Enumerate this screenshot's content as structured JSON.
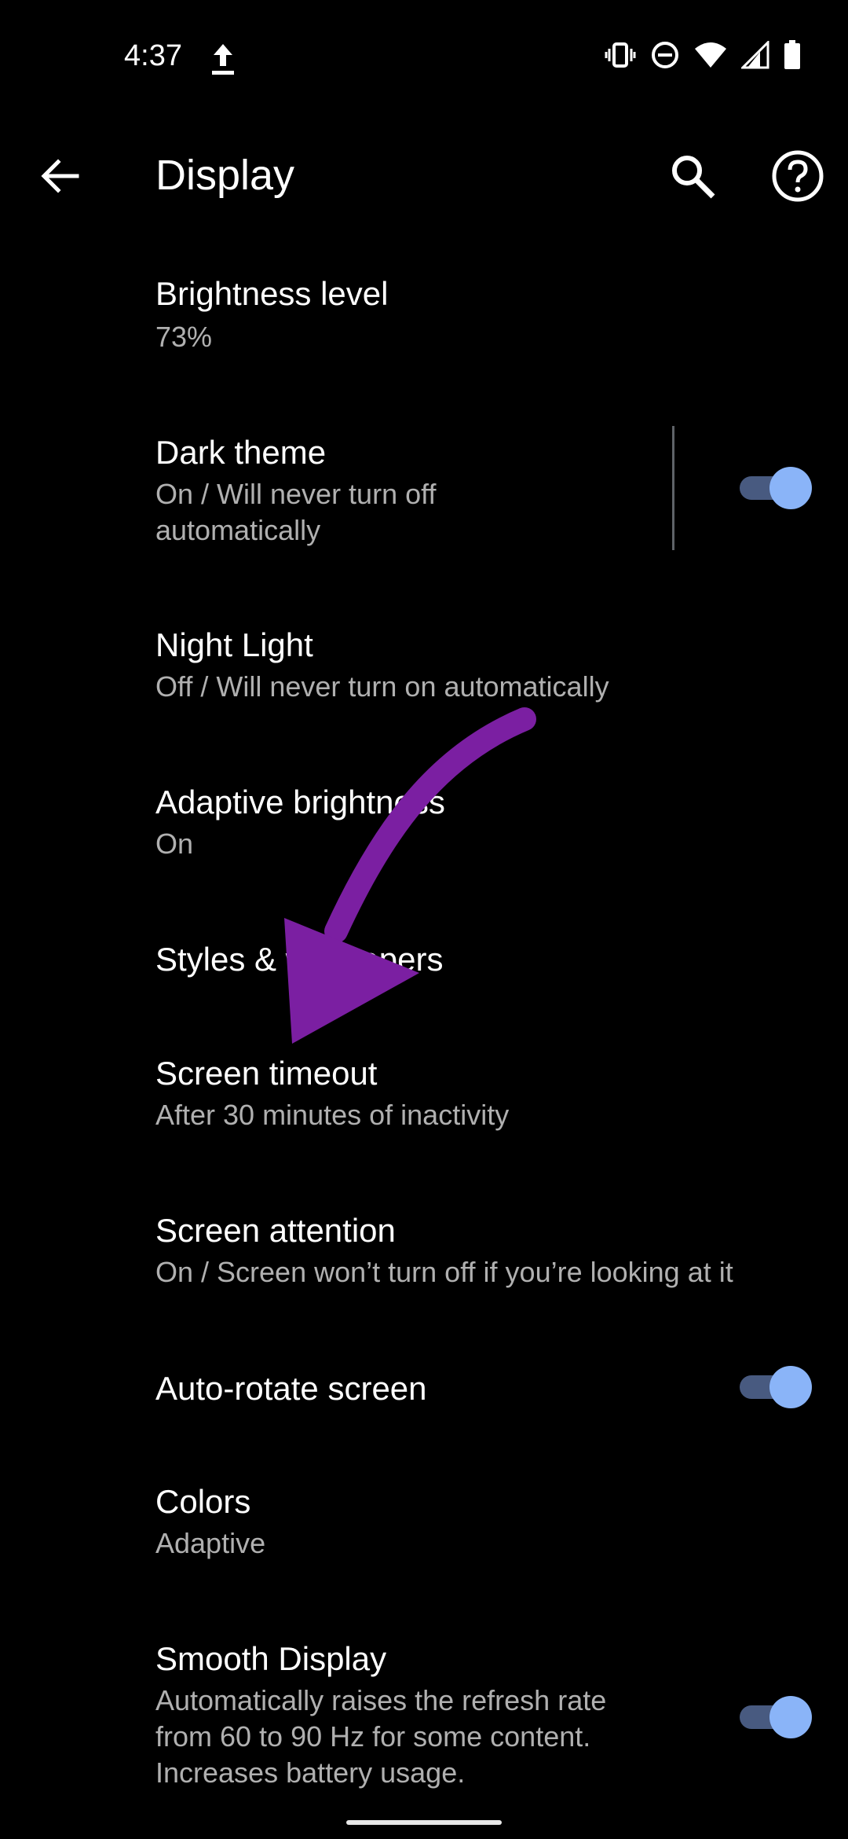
{
  "status_bar": {
    "time": "4:37",
    "icons": [
      "upload-icon",
      "vibrate-icon",
      "do-not-disturb-icon",
      "wifi-icon",
      "signal-icon",
      "battery-icon"
    ]
  },
  "app_bar": {
    "title": "Display",
    "back_icon": "arrow-back-icon",
    "search_icon": "search-icon",
    "help_icon": "help-icon"
  },
  "settings": [
    {
      "title": "Brightness level",
      "summary": "73%"
    },
    {
      "title": "Dark theme",
      "summary": "On / Will never turn off\nautomatically",
      "toggle": true
    },
    {
      "title": "Night Light",
      "summary": "Off / Will never turn on automatically"
    },
    {
      "title": "Adaptive brightness",
      "summary": "On"
    },
    {
      "title": "Styles & wallpapers"
    },
    {
      "title": "Screen timeout",
      "summary": "After 30 minutes of inactivity"
    },
    {
      "title": "Screen attention",
      "summary": "On / Screen won’t turn off if you’re looking at it"
    },
    {
      "title": "Auto-rotate screen",
      "toggle": true
    },
    {
      "title": "Colors",
      "summary": "Adaptive"
    },
    {
      "title": "Smooth Display",
      "summary": "Automatically raises the refresh rate\nfrom 60 to 90 Hz for some content.\nIncreases battery usage.",
      "toggle": true
    }
  ],
  "colors": {
    "background": "#000000",
    "summary_text": "#b0b0b0",
    "toggle_thumb": "#8ab4f8",
    "toggle_track": "#485a80",
    "annotation_arrow": "#7b1fa2"
  }
}
